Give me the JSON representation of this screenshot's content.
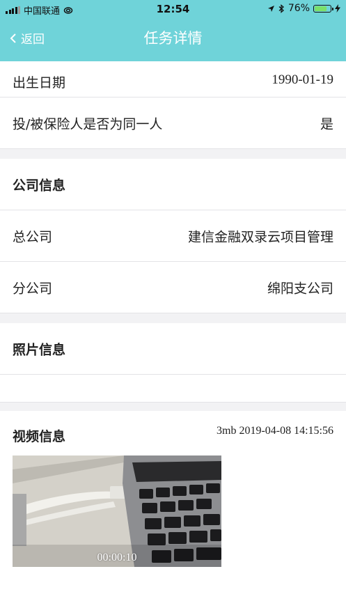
{
  "status_bar": {
    "carrier": "中国联通",
    "time": "12:54",
    "battery_percent": "76%",
    "battery_level": 0.76
  },
  "nav": {
    "back_label": "返回",
    "title": "任务详情"
  },
  "rows": {
    "birth_label": "出生日期",
    "birth_value": "1990-01-19",
    "same_person_label": "投/被保险人是否为同一人",
    "same_person_value": "是",
    "company_section": "公司信息",
    "head_office_label": "总公司",
    "head_office_value": "建信金融双录云项目管理",
    "branch_label": "分公司",
    "branch_value": "绵阳支公司",
    "photo_section": "照片信息",
    "video_section": "视频信息",
    "video_meta": "3mb 2019-04-08 14:15:56",
    "video_duration": "00:00:10"
  },
  "colors": {
    "header": "#6fd3d9",
    "battery": "#7be06a"
  }
}
